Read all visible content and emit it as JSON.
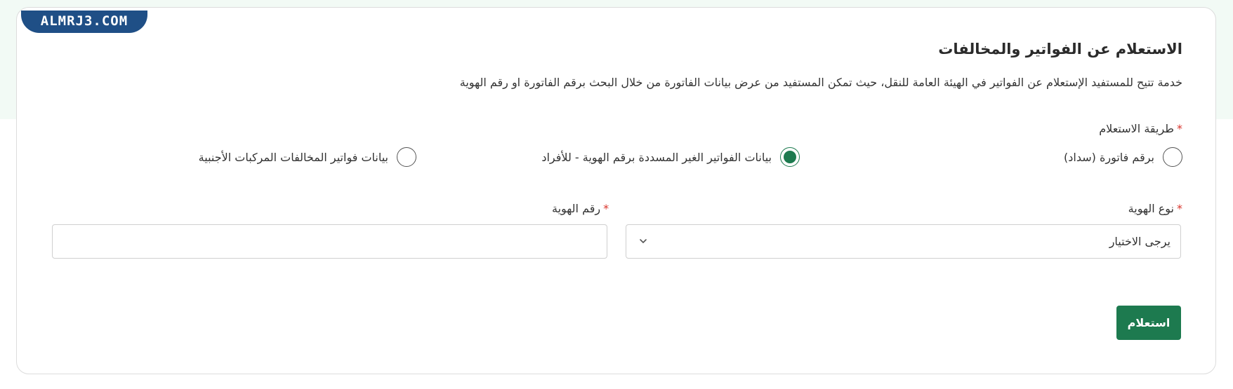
{
  "watermark": "ALMRJ3.COM",
  "header": {
    "title": "الاستعلام عن الفواتير والمخالفات",
    "description": "خدمة تتيح للمستفيد الإستعلام عن الفواتير في الهيئة العامة للنقل، حيث تمكن المستفيد من عرض بيانات الفاتورة من خلال البحث برقم الفاتورة او رقم الهوية"
  },
  "inquiry_method": {
    "label": "طريقة الاستعلام",
    "required_mark": "*",
    "options": [
      {
        "label": "برقم فاتورة (سداد)",
        "selected": false
      },
      {
        "label": "بيانات الفواتير الغير المسددة برقم الهوية - للأفراد",
        "selected": true
      },
      {
        "label": "بيانات فواتير المخالفات المركبات الأجنبية",
        "selected": false
      }
    ]
  },
  "id_type": {
    "label": "نوع الهوية",
    "required_mark": "*",
    "selected_value": "يرجى الاختيار",
    "icon": "chevron-down-icon"
  },
  "id_number": {
    "label": "رقم الهوية",
    "required_mark": "*",
    "value": "",
    "placeholder": ""
  },
  "submit": {
    "label": "استعلام"
  },
  "colors": {
    "accent": "#1d7a4f",
    "required": "#d9342b",
    "background_band": "#f2faf5",
    "watermark_bg": "#1f4f86"
  }
}
